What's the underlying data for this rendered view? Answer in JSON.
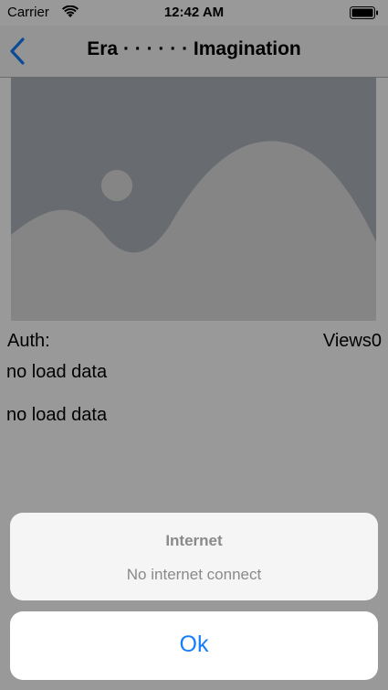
{
  "status_bar": {
    "carrier": "Carrier",
    "time": "12:42 AM"
  },
  "nav": {
    "title": "Era · · · · · · Imagination",
    "back_icon": "chevron-left-icon"
  },
  "content": {
    "image_icon": "image-placeholder-icon",
    "auth_label": "Auth:",
    "views_label": "Views0",
    "text_1": "no load data",
    "text_2": "no load data"
  },
  "alert": {
    "title": "Internet",
    "message": "No internet connect",
    "ok_label": "Ok"
  },
  "colors": {
    "accent": "#157efb",
    "placeholder_bg": "#aeb5bb",
    "placeholder_shape": "#dedede",
    "overlay": "rgba(0,0,0,0.40)"
  }
}
